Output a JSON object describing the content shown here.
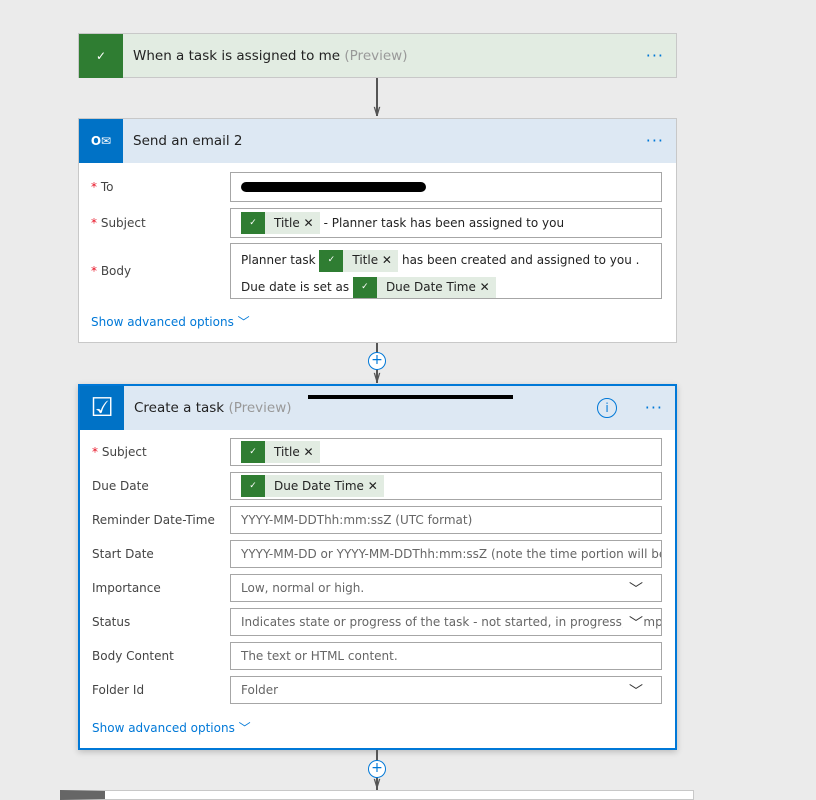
{
  "trigger": {
    "title": "When a task is assigned to me",
    "preview": "(Preview)",
    "more": "···",
    "icon": "planner-icon",
    "color": "#2f7d32"
  },
  "email": {
    "title": "Send an email 2",
    "more": "···",
    "icon": "outlook-icon",
    "color": "#0072c6",
    "to_label": "To",
    "subject_label": "Subject",
    "body_label": "Body",
    "subject_token": "Title",
    "subject_text": "- Planner task has been assigned to you",
    "body_text1": "Planner task",
    "body_token1": "Title",
    "body_text2": "has been created and assigned to you . Due",
    "body_text3": "date is set as",
    "body_token2": "Due Date Time",
    "advanced": "Show advanced options"
  },
  "task": {
    "title": "Create a task",
    "preview": "(Preview)",
    "more": "···",
    "info": "i",
    "icon": "checkbox-icon",
    "fields": [
      {
        "label": "Subject",
        "required": true,
        "token": "Title"
      },
      {
        "label": "Due Date",
        "token": "Due Date Time"
      },
      {
        "label": "Reminder Date-Time",
        "placeholder": "YYYY-MM-DDThh:mm:ssZ (UTC format)"
      },
      {
        "label": "Start Date",
        "placeholder": "YYYY-MM-DD or YYYY-MM-DDThh:mm:ssZ (note the time portion will be ignored)"
      },
      {
        "label": "Importance",
        "placeholder": "Low, normal or high.",
        "dropdown": true
      },
      {
        "label": "Status",
        "placeholder": "Indicates state or progress of the task - not started, in progress, completed",
        "dropdown": true
      },
      {
        "label": "Body Content",
        "placeholder": "The text or HTML content."
      },
      {
        "label": "Folder Id",
        "placeholder": "Folder",
        "dropdown": true
      }
    ],
    "advanced": "Show advanced options"
  },
  "token_close": "✕",
  "required_mark": "*"
}
